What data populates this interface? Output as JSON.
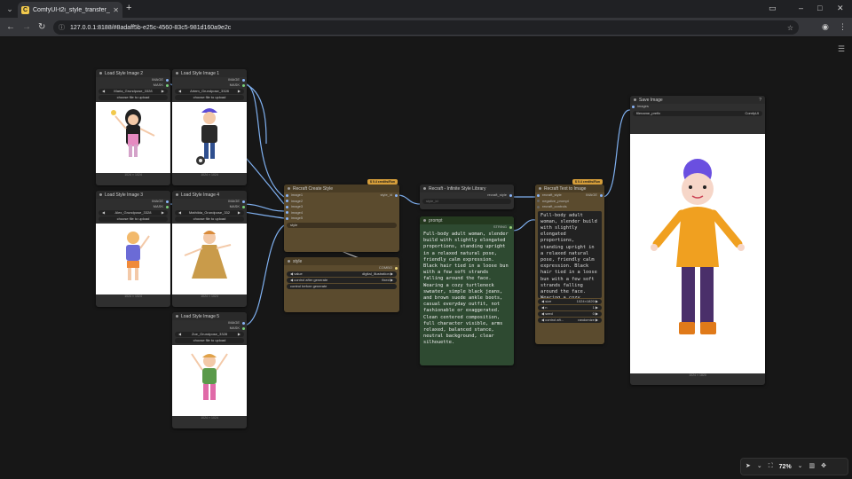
{
  "browser": {
    "tab_title": "ComfyUI-t2i_style_transfer_000",
    "url": "127.0.0.1:8188/#8adaff5b-e25c-4560-83c5-981d160a9e2c"
  },
  "load_nodes": [
    {
      "title": "Load Style Image 2",
      "file": "Maria_Grundpose_3328",
      "upload": "choose file to upload",
      "dims": "1024 × 1024",
      "out1": "IMAGE",
      "out2": "MASK"
    },
    {
      "title": "Load Style Image 1",
      "file": "Artem_Grundpose_3328",
      "upload": "choose file to upload",
      "dims": "1024 × 1024",
      "out1": "IMAGE",
      "out2": "MASK"
    },
    {
      "title": "Load Style Image 3",
      "file": "Alex_Grundpose_3328",
      "upload": "choose file to upload",
      "dims": "1024 × 1024",
      "out1": "IMAGE",
      "out2": "MASK"
    },
    {
      "title": "Load Style Image 4",
      "file": "Mathilda_Grundpose_332",
      "upload": "choose file to upload",
      "dims": "1024 × 1024",
      "out1": "IMAGE",
      "out2": "MASK"
    },
    {
      "title": "Load Style Image 5",
      "file": "Zoe_Grundpose_3328",
      "upload": "choose file to upload",
      "dims": "1024 × 1024",
      "out1": "IMAGE",
      "out2": "MASK"
    }
  ],
  "create_style": {
    "title": "Recraft Create Style",
    "badge": "$ 0.4 credits/Run",
    "output": "style_id",
    "inputs": [
      "image1",
      "image2",
      "image3",
      "image4",
      "image5"
    ],
    "style_field": "style"
  },
  "style_node": {
    "title": "style",
    "output": "COMBO",
    "value_label": "value",
    "value": "digital_illustration",
    "control_label": "control after generate",
    "control_value": "fixed",
    "control_before": "control before generate"
  },
  "library_node": {
    "title": "Recraft - Infinite Style Library",
    "output": "recraft_style",
    "style_id_placeholder": "style_id"
  },
  "prompt_node": {
    "title": "prompt",
    "output": "STRING",
    "text": "Full-body adult woman, slender build with slightly elongated proportions, standing upright in a relaxed natural pose, friendly calm expression. Black hair tied in a loose bun with a few soft strands falling around the face. Wearing a cozy turtleneck sweater, simple black jeans, and brown suede ankle boots, casual everyday outfit, not fashionable or exaggerated. Clean centered composition, full character visible, arms relaxed, balanced stance, neutral background, clear silhouette."
  },
  "text_to_image": {
    "title": "Recraft Text to Image",
    "badge": "$ 0.4 credits/Run",
    "output": "IMAGE",
    "inputs": [
      "recraft_style",
      "negative_prompt",
      "recraft_controls"
    ],
    "prompt_text": "Full-body adult woman, slender build with slightly elongated proportions, standing upright in a relaxed natural pose, friendly calm expression. Black hair tied in a loose bun with a few soft strands falling around the face. Wearing a cozy turtleneck sweater, simple black jeans, and brown suede",
    "size_label": "size",
    "size_value": "1024×1820",
    "n_label": "n",
    "n_value": "1",
    "seed_label": "seed",
    "seed_value": "0",
    "control_label": "control aft...",
    "control_value": "randomize"
  },
  "save_node": {
    "title": "Save Image",
    "input": "images",
    "prefix_label": "filename_prefix",
    "prefix_value": "ComfyUI",
    "dims": "1024 × 1820"
  },
  "toolbar": {
    "zoom": "72%"
  },
  "colors": {
    "link": "#7fb0f0",
    "brown_node": "#5b4b2e",
    "green_node": "#2e4a31",
    "credit_badge": "#d69e3a"
  }
}
